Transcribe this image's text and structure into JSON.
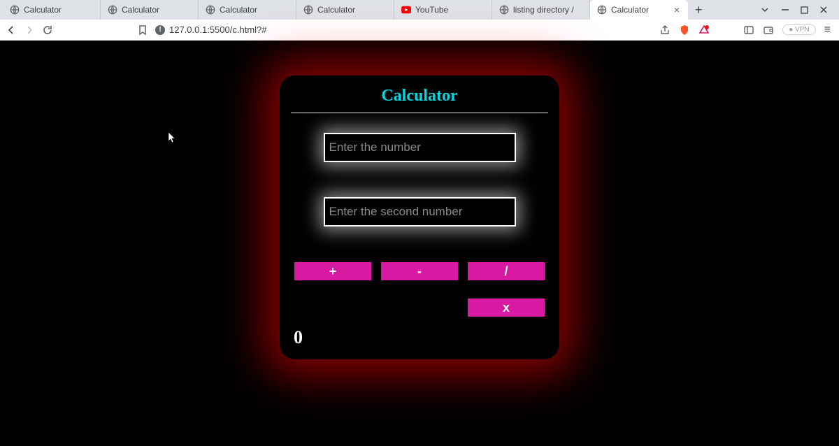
{
  "browser": {
    "tabs": [
      {
        "label": "Calculator",
        "icon": "globe"
      },
      {
        "label": "Calculator",
        "icon": "globe"
      },
      {
        "label": "Calculator",
        "icon": "globe"
      },
      {
        "label": "Calculator",
        "icon": "globe"
      },
      {
        "label": "YouTube",
        "icon": "youtube"
      },
      {
        "label": "listing directory /",
        "icon": "globe"
      },
      {
        "label": "Calculator",
        "icon": "globe",
        "active": true
      }
    ],
    "url": "127.0.0.1:5500/c.html?#",
    "vpn_label": "VPN"
  },
  "calculator": {
    "title": "Calculator",
    "input1": {
      "value": "",
      "placeholder": "Enter the number"
    },
    "input2": {
      "value": "",
      "placeholder": "Enter the second number"
    },
    "ops": {
      "add": "+",
      "sub": "-",
      "div": "/",
      "mul": "x"
    },
    "result": "0"
  }
}
